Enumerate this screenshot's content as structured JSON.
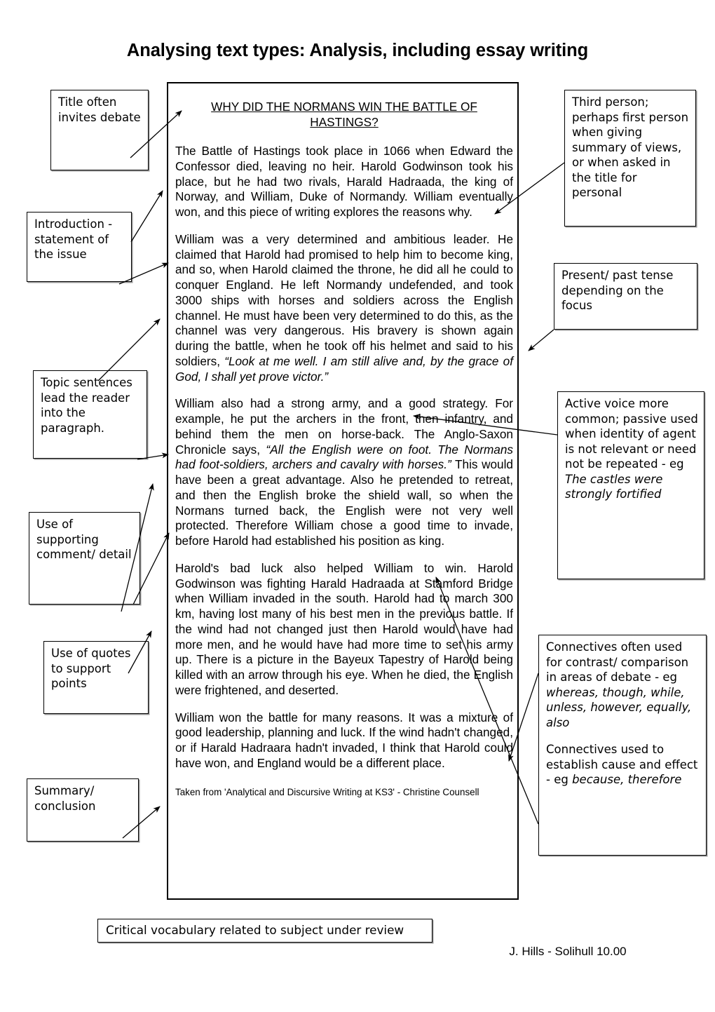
{
  "page": {
    "title": "Analysing text types: Analysis, including essay writing",
    "footer_credit": "J. Hills - Solihull 10.00"
  },
  "essay": {
    "heading": "WHY DID THE NORMANS WIN THE BATTLE OF HASTINGS?",
    "paragraphs": [
      "The Battle of Hastings took place in 1066 when Edward the Confessor died, leaving no heir.  Harold Godwinson took his place, but he had two rivals, Harald Hadraada, the king of Norway, and William, Duke of Normandy.  William eventually won, and this piece of writing explores the reasons why.",
      "William was a very determined and ambitious leader.  He claimed that Harold had promised to help him to become king, and so, when Harold claimed the throne, he did all he could to conquer England.   He left Normandy undefended, and took 3000 ships with horses and soldiers across the English channel.  He must have been very determined to do this, as the channel was very dangerous.  His bravery is shown again during the battle, when he took off his helmet and said to his soldiers, ",
      "William also had a strong army, and a good strategy.  For example, he put the archers in the front, then infantry, and behind them the men on horse-back.  The Anglo-Saxon Chronicle says, ",
      "Harold's bad luck also helped William to win.  Harold Godwinson was fighting Harald Hadraada at Stamford Bridge when William invaded in the south.  Harold had to march 300 km, having lost many of his best men in the previous battle.  If the wind had not changed just then Harold would have had more men, and he would have had more time to set his army up.  There is a picture in the Bayeux Tapestry of Harold being killed with an arrow through his eye.  When he died, the English were frightened, and deserted.",
      "William won the battle for many reasons.  It was a mixture of good leadership, planning and luck.  If the wind hadn't changed, or if Harald Hadraara hadn't invaded, I think that Harold could have won, and England would be a different place."
    ],
    "quote_para2": "“Look at me well.  I am still alive and, by the grace of God, I shall yet prove victor.”",
    "quote_para3": "“All the English were on foot.  The Normans had foot-soldiers, archers and cavalry with horses.”",
    "para3_tail": " This would have been a great advantage. Also he pretended to retreat, and then the English broke the shield wall, so when the Normans turned back, the English were not very well protected. Therefore William chose a good time to invade, before Harold had established his position as king.",
    "source": "Taken from 'Analytical and Discursive Writing at KS3' - Christine Counsell"
  },
  "callouts": {
    "title_debate": "Title often invites debate",
    "introduction": "Introduction - statement of the issue",
    "topic_sentences": "Topic sentences lead the reader into the paragraph.",
    "supporting": "Use of supporting comment/ detail",
    "quotes": "Use of quotes to support points",
    "summary": "Summary/ conclusion",
    "third_person": "Third person; perhaps first person when giving summary of views, or when asked in the title for personal",
    "tense": "Present/ past tense depending on the focus",
    "active_voice_plain": "Active voice more common; passive used when identity of agent is not relevant or need not be repeated - eg ",
    "active_voice_example": "The castles were strongly fortified",
    "connectives_contrast_plain": "Connectives often used for contrast/ comparison in areas of debate - eg ",
    "connectives_contrast_example": "whereas, though, while, unless, however, equally, also",
    "connectives_cause_plain": "Connectives used to establish cause and effect - eg ",
    "connectives_cause_example": "because, therefore",
    "critical_vocabulary": "Critical vocabulary related to subject under review"
  },
  "colors": {
    "ink": "#000000",
    "box_shadow": "#9a9a9a",
    "page_background": "#ffffff"
  }
}
